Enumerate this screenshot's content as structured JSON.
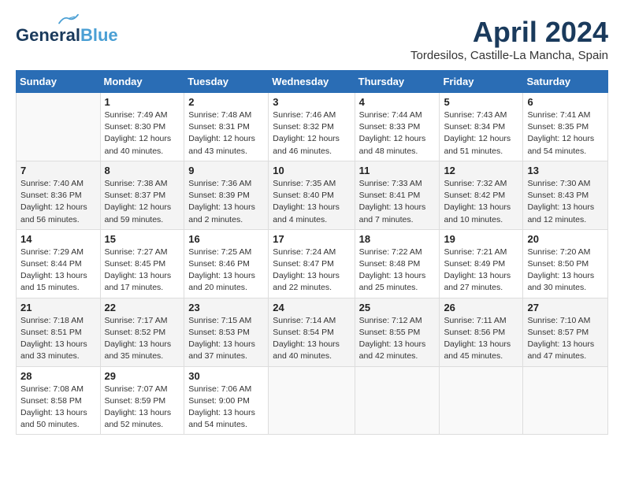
{
  "header": {
    "logo_general": "General",
    "logo_blue": "Blue",
    "month_title": "April 2024",
    "location": "Tordesilos, Castille-La Mancha, Spain"
  },
  "calendar": {
    "days_of_week": [
      "Sunday",
      "Monday",
      "Tuesday",
      "Wednesday",
      "Thursday",
      "Friday",
      "Saturday"
    ],
    "weeks": [
      [
        {
          "day": "",
          "info": ""
        },
        {
          "day": "1",
          "info": "Sunrise: 7:49 AM\nSunset: 8:30 PM\nDaylight: 12 hours\nand 40 minutes."
        },
        {
          "day": "2",
          "info": "Sunrise: 7:48 AM\nSunset: 8:31 PM\nDaylight: 12 hours\nand 43 minutes."
        },
        {
          "day": "3",
          "info": "Sunrise: 7:46 AM\nSunset: 8:32 PM\nDaylight: 12 hours\nand 46 minutes."
        },
        {
          "day": "4",
          "info": "Sunrise: 7:44 AM\nSunset: 8:33 PM\nDaylight: 12 hours\nand 48 minutes."
        },
        {
          "day": "5",
          "info": "Sunrise: 7:43 AM\nSunset: 8:34 PM\nDaylight: 12 hours\nand 51 minutes."
        },
        {
          "day": "6",
          "info": "Sunrise: 7:41 AM\nSunset: 8:35 PM\nDaylight: 12 hours\nand 54 minutes."
        }
      ],
      [
        {
          "day": "7",
          "info": "Sunrise: 7:40 AM\nSunset: 8:36 PM\nDaylight: 12 hours\nand 56 minutes."
        },
        {
          "day": "8",
          "info": "Sunrise: 7:38 AM\nSunset: 8:37 PM\nDaylight: 12 hours\nand 59 minutes."
        },
        {
          "day": "9",
          "info": "Sunrise: 7:36 AM\nSunset: 8:39 PM\nDaylight: 13 hours\nand 2 minutes."
        },
        {
          "day": "10",
          "info": "Sunrise: 7:35 AM\nSunset: 8:40 PM\nDaylight: 13 hours\nand 4 minutes."
        },
        {
          "day": "11",
          "info": "Sunrise: 7:33 AM\nSunset: 8:41 PM\nDaylight: 13 hours\nand 7 minutes."
        },
        {
          "day": "12",
          "info": "Sunrise: 7:32 AM\nSunset: 8:42 PM\nDaylight: 13 hours\nand 10 minutes."
        },
        {
          "day": "13",
          "info": "Sunrise: 7:30 AM\nSunset: 8:43 PM\nDaylight: 13 hours\nand 12 minutes."
        }
      ],
      [
        {
          "day": "14",
          "info": "Sunrise: 7:29 AM\nSunset: 8:44 PM\nDaylight: 13 hours\nand 15 minutes."
        },
        {
          "day": "15",
          "info": "Sunrise: 7:27 AM\nSunset: 8:45 PM\nDaylight: 13 hours\nand 17 minutes."
        },
        {
          "day": "16",
          "info": "Sunrise: 7:25 AM\nSunset: 8:46 PM\nDaylight: 13 hours\nand 20 minutes."
        },
        {
          "day": "17",
          "info": "Sunrise: 7:24 AM\nSunset: 8:47 PM\nDaylight: 13 hours\nand 22 minutes."
        },
        {
          "day": "18",
          "info": "Sunrise: 7:22 AM\nSunset: 8:48 PM\nDaylight: 13 hours\nand 25 minutes."
        },
        {
          "day": "19",
          "info": "Sunrise: 7:21 AM\nSunset: 8:49 PM\nDaylight: 13 hours\nand 27 minutes."
        },
        {
          "day": "20",
          "info": "Sunrise: 7:20 AM\nSunset: 8:50 PM\nDaylight: 13 hours\nand 30 minutes."
        }
      ],
      [
        {
          "day": "21",
          "info": "Sunrise: 7:18 AM\nSunset: 8:51 PM\nDaylight: 13 hours\nand 33 minutes."
        },
        {
          "day": "22",
          "info": "Sunrise: 7:17 AM\nSunset: 8:52 PM\nDaylight: 13 hours\nand 35 minutes."
        },
        {
          "day": "23",
          "info": "Sunrise: 7:15 AM\nSunset: 8:53 PM\nDaylight: 13 hours\nand 37 minutes."
        },
        {
          "day": "24",
          "info": "Sunrise: 7:14 AM\nSunset: 8:54 PM\nDaylight: 13 hours\nand 40 minutes."
        },
        {
          "day": "25",
          "info": "Sunrise: 7:12 AM\nSunset: 8:55 PM\nDaylight: 13 hours\nand 42 minutes."
        },
        {
          "day": "26",
          "info": "Sunrise: 7:11 AM\nSunset: 8:56 PM\nDaylight: 13 hours\nand 45 minutes."
        },
        {
          "day": "27",
          "info": "Sunrise: 7:10 AM\nSunset: 8:57 PM\nDaylight: 13 hours\nand 47 minutes."
        }
      ],
      [
        {
          "day": "28",
          "info": "Sunrise: 7:08 AM\nSunset: 8:58 PM\nDaylight: 13 hours\nand 50 minutes."
        },
        {
          "day": "29",
          "info": "Sunrise: 7:07 AM\nSunset: 8:59 PM\nDaylight: 13 hours\nand 52 minutes."
        },
        {
          "day": "30",
          "info": "Sunrise: 7:06 AM\nSunset: 9:00 PM\nDaylight: 13 hours\nand 54 minutes."
        },
        {
          "day": "",
          "info": ""
        },
        {
          "day": "",
          "info": ""
        },
        {
          "day": "",
          "info": ""
        },
        {
          "day": "",
          "info": ""
        }
      ]
    ]
  }
}
